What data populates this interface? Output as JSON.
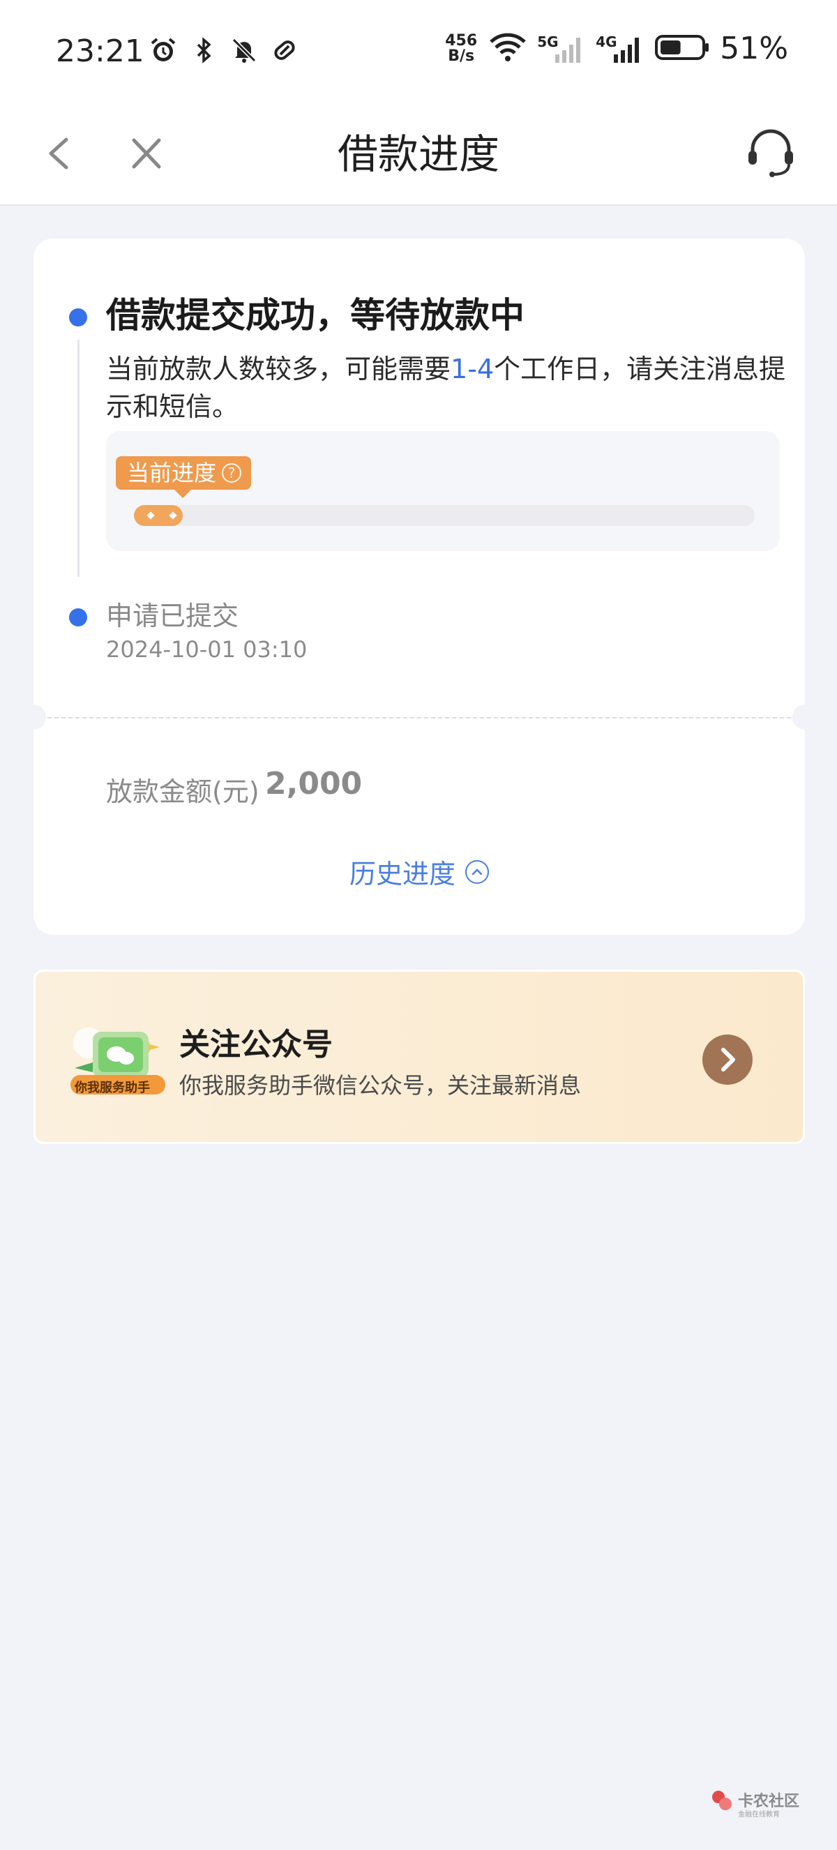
{
  "status_bar": {
    "time": "23:21",
    "net_speed_value": "456",
    "net_speed_unit": "B/s",
    "signal_5g": "5G",
    "signal_4g": "4G",
    "battery_percent": "51%",
    "battery_level": 0.51
  },
  "nav": {
    "title": "借款进度"
  },
  "progress": {
    "step1_title": "借款提交成功，等待放款中",
    "step1_desc_before": "当前放款人数较多，可能需要",
    "step1_desc_highlight": "1-4",
    "step1_desc_after": "个工作日，请关注消息提示和短信。",
    "tag_label": "当前进度",
    "help_glyph": "?",
    "progress_fraction": 0.05,
    "step2_title": "申请已提交",
    "step2_time": "2024-10-01 03:10"
  },
  "amount": {
    "label": "放款金额(元)",
    "value": "2,000"
  },
  "history": {
    "label": "历史进度"
  },
  "follow": {
    "logo_label": "你我服务助手",
    "title": "关注公众号",
    "subtitle": "你我服务助手微信公众号，关注最新消息"
  },
  "watermark": {
    "text": "卡农社区",
    "sub": "金融在线教育"
  },
  "colors": {
    "accent_blue": "#3571e8",
    "progress_orange": "#ef9a4d",
    "banner_arrow": "#a07454"
  }
}
